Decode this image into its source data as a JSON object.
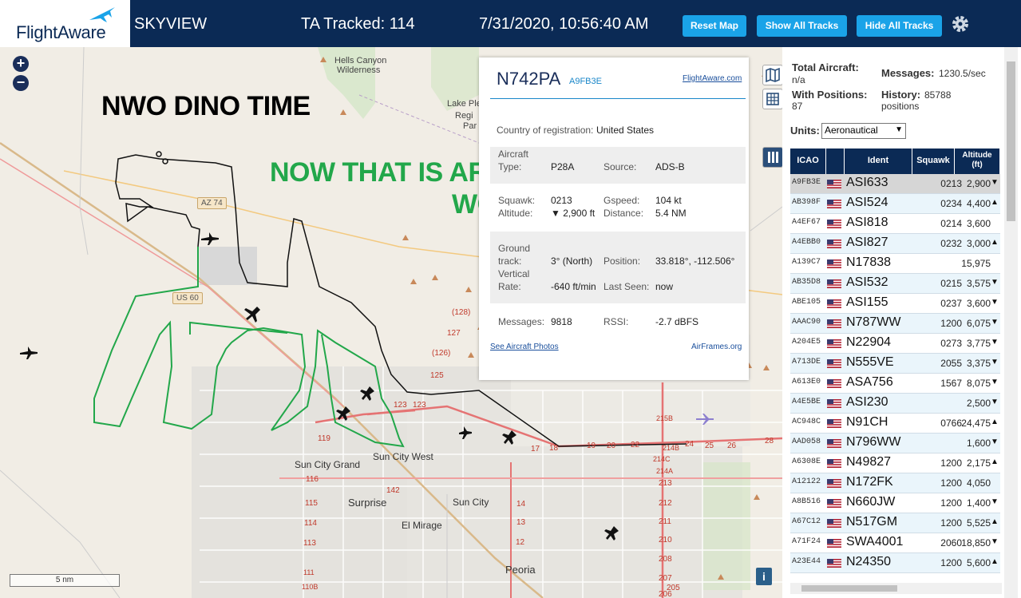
{
  "header": {
    "logo": "FlightAware",
    "site": "SKYVIEW",
    "tracked": "TA Tracked: 114",
    "datetime": "7/31/2020, 10:56:40 AM",
    "buttons": [
      "Reset Map",
      "Show All Tracks",
      "Hide All Tracks"
    ],
    "accent": "#1aa3e8",
    "bg": "#0b2a55"
  },
  "map": {
    "annotation_dino": "NWO DINO TIME",
    "annotation_art_1": "NOW THAT IS ART",
    "annotation_art_2": "WORK",
    "places": [
      "Hells Canyon",
      "Wilderness",
      "Lake Ple",
      "Regi",
      "Par",
      "Sun City Grand",
      "Sun City West",
      "Surprise",
      "Sun City",
      "El Mirage",
      "Peoria"
    ],
    "shields": [
      "AZ 74",
      "US 60"
    ],
    "road_numbers": [
      "(128)",
      "127",
      "(126)",
      "125",
      "123",
      "123",
      "119",
      "116",
      "115",
      "114",
      "113",
      "142",
      "14",
      "13",
      "12",
      "17",
      "18",
      "19",
      "20",
      "22",
      "24",
      "25",
      "26",
      "28",
      "215B",
      "214C",
      "214A",
      "214B",
      "213",
      "212",
      "211",
      "210",
      "208",
      "207",
      "206",
      "205",
      "110B",
      "111"
    ],
    "scale": "5 nm",
    "zoom_in": "+",
    "zoom_out": "−",
    "info": "i"
  },
  "panel": {
    "registration": "N742PA",
    "hex": "A9FB3E",
    "fa_link": "FlightAware.com",
    "country_label": "Country of registration:",
    "country": "United States",
    "aircraft_type_label_1": "Aircraft",
    "aircraft_type_label_2": "Type:",
    "aircraft_type": "P28A",
    "source_label": "Source:",
    "source": "ADS-B",
    "squawk_label": "Squawk:",
    "squawk": "0213",
    "altitude_label": "Altitude:",
    "altitude": "▼ 2,900 ft",
    "gspeed_label": "Gspeed:",
    "gspeed": "104 kt",
    "distance_label": "Distance:",
    "distance": "5.4 NM",
    "ground_track_label_1": "Ground",
    "ground_track_label_2": "track:",
    "ground_track": "3° (North)",
    "position_label": "Position:",
    "position": "33.818°, -112.506°",
    "vrate_label_1": "Vertical",
    "vrate_label_2": "Rate:",
    "vrate": "-640 ft/min",
    "last_seen_label": "Last Seen:",
    "last_seen": "now",
    "messages_label": "Messages:",
    "messages": "9818",
    "rssi_label": "RSSI:",
    "rssi": "-2.7 dBFS",
    "photos_link": "See Aircraft Photos",
    "airframes_link": "AirFrames.org"
  },
  "sidebar": {
    "total_label": "Total Aircraft:",
    "total": "n/a",
    "messages_label": "Messages:",
    "messages": "1230.5/sec",
    "positions_label": "With Positions:",
    "positions": "87",
    "history_label": "History:",
    "history": "85788",
    "history_unit": "positions",
    "units_label": "Units:",
    "units_value": "Aeronautical",
    "columns": [
      "ICAO",
      "Ident",
      "Squawk",
      "Altitude (ft)"
    ],
    "rows": [
      {
        "icao": "A9FB3E",
        "ident": "ASI633",
        "squawk": "0213",
        "alt": "2,900",
        "trend": "▼"
      },
      {
        "icao": "AB398F",
        "ident": "ASI524",
        "squawk": "0234",
        "alt": "4,400",
        "trend": "▲"
      },
      {
        "icao": "A4EF67",
        "ident": "ASI818",
        "squawk": "0214",
        "alt": "3,600",
        "trend": ""
      },
      {
        "icao": "A4EBB0",
        "ident": "ASI827",
        "squawk": "0232",
        "alt": "3,000",
        "trend": "▲"
      },
      {
        "icao": "A139C7",
        "ident": "N17838",
        "squawk": "",
        "alt": "15,975",
        "trend": ""
      },
      {
        "icao": "AB35D8",
        "ident": "ASI532",
        "squawk": "0215",
        "alt": "3,575",
        "trend": "▼"
      },
      {
        "icao": "ABE105",
        "ident": "ASI155",
        "squawk": "0237",
        "alt": "3,600",
        "trend": "▼"
      },
      {
        "icao": "AAAC90",
        "ident": "N787WW",
        "squawk": "1200",
        "alt": "6,075",
        "trend": "▼"
      },
      {
        "icao": "A204E5",
        "ident": "N22904",
        "squawk": "0273",
        "alt": "3,775",
        "trend": "▼"
      },
      {
        "icao": "A713DE",
        "ident": "N555VE",
        "squawk": "2055",
        "alt": "3,375",
        "trend": "▼"
      },
      {
        "icao": "A613E0",
        "ident": "ASA756",
        "squawk": "1567",
        "alt": "8,075",
        "trend": "▼"
      },
      {
        "icao": "A4E5BE",
        "ident": "ASI230",
        "squawk": "",
        "alt": "2,500",
        "trend": "▼"
      },
      {
        "icao": "AC948C",
        "ident": "N91CH",
        "squawk": "0766",
        "alt": "24,475",
        "trend": "▲"
      },
      {
        "icao": "AAD058",
        "ident": "N796WW",
        "squawk": "",
        "alt": "1,600",
        "trend": "▼"
      },
      {
        "icao": "A6308E",
        "ident": "N49827",
        "squawk": "1200",
        "alt": "2,175",
        "trend": "▲"
      },
      {
        "icao": "A12122",
        "ident": "N172FK",
        "squawk": "1200",
        "alt": "4,050",
        "trend": ""
      },
      {
        "icao": "A8B516",
        "ident": "N660JW",
        "squawk": "1200",
        "alt": "1,400",
        "trend": "▼"
      },
      {
        "icao": "A67C12",
        "ident": "N517GM",
        "squawk": "1200",
        "alt": "5,525",
        "trend": "▲"
      },
      {
        "icao": "A71F24",
        "ident": "SWA4001",
        "squawk": "2060",
        "alt": "18,850",
        "trend": "▼"
      },
      {
        "icao": "A23E44",
        "ident": "N24350",
        "squawk": "1200",
        "alt": "5,600",
        "trend": "▲"
      }
    ]
  }
}
